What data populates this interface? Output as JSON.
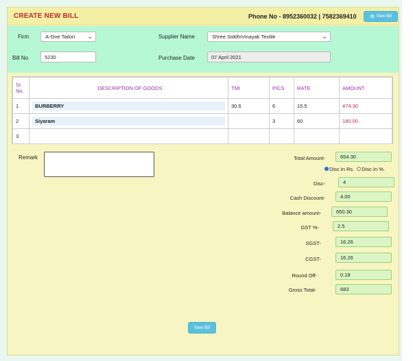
{
  "header": {
    "title": "CREATE NEW BILL",
    "phone": "Phone No - 8952360032 | 7582369410",
    "view_bill_label": "View Bill",
    "view_bill_icon": "eye-icon"
  },
  "form": {
    "firm_label": "Firm",
    "firm_value": "A-One Tailori",
    "supplier_label": "Supplier Name",
    "supplier_value": "Shree SiddhiVinayak Textile",
    "bill_no_label": "Bill No",
    "bill_no_value": "5230",
    "purchase_date_label": "Purchase Date",
    "purchase_date_value": "07 April 2021"
  },
  "table": {
    "headers": [
      "Sr No.",
      "DESCRIPTION OF GOODS",
      "TMI",
      "PICS",
      "RATE",
      "AMOUNT"
    ],
    "rows": [
      {
        "sr": "1",
        "desc": "BURBERRY",
        "tmi": "30.6",
        "pics": "6",
        "rate": "15.5",
        "amount": "474.30"
      },
      {
        "sr": "2",
        "desc": "Siyaram",
        "tmi": "",
        "pics": "3",
        "rate": "60",
        "amount": "180.00"
      },
      {
        "sr": "3",
        "desc": "",
        "tmi": "",
        "pics": "",
        "rate": "",
        "amount": ""
      }
    ]
  },
  "remark": {
    "label": "Remark",
    "value": ""
  },
  "summary": {
    "total_amount_label": "Total Amount-",
    "total_amount": "654.30",
    "disc_rs_label": "Disc In Rs.",
    "disc_pct_label": "Disc In %.",
    "disc_label": "Disc-",
    "disc": "4",
    "cash_discount_label": "Cash Discount-",
    "cash_discount": "4.00",
    "balance_label": "Balance amount-",
    "balance": "650.30",
    "gst_pct_label": "GST %-",
    "gst_pct": "2.5",
    "sgst_label": "SGST-",
    "sgst": "16.26",
    "cgst_label": "CGST-",
    "cgst": "16.26",
    "round_off_label": "Round Off-",
    "round_off": "0.18",
    "gross_total_label": "Gross Total-",
    "gross_total": "683"
  },
  "save_label": "Save Bill",
  "colors": {
    "title_red": "#c1272d",
    "header_purple": "#9c27b0",
    "button_blue": "#5bc0de",
    "form_green": "#b6f7d4"
  }
}
